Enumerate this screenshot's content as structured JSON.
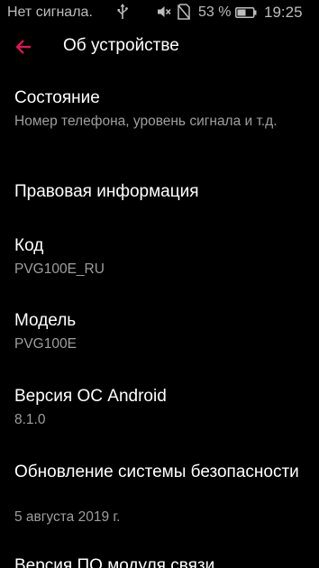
{
  "status_bar": {
    "carrier": "Нет сигнала.",
    "battery_percent": "53 %",
    "battery_level": 0.53,
    "time": "19:25",
    "icons": [
      "usb-icon",
      "mute-icon",
      "no-sim-icon",
      "battery-icon"
    ]
  },
  "app_bar": {
    "title": "Об устройстве",
    "back_icon": "arrow-back-icon",
    "accent_color": "#e8125c"
  },
  "items": [
    {
      "title": "Состояние",
      "summary": "Номер телефона, уровень сигнала и т.д."
    },
    {
      "title": "Правовая информация",
      "summary": ""
    },
    {
      "title": "Код",
      "summary": "PVG100E_RU"
    },
    {
      "title": "Модель",
      "summary": "PVG100E"
    },
    {
      "title": "Версия ОС Android",
      "summary": "8.1.0"
    },
    {
      "title": "Обновление системы безопасности",
      "summary": "5 августа 2019 г."
    },
    {
      "title": "Версия ПО модуля связи",
      "summary": ""
    }
  ]
}
